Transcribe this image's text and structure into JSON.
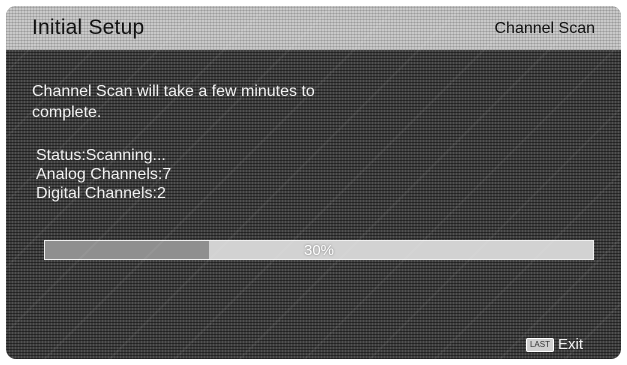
{
  "header": {
    "title": "Initial Setup",
    "subtitle": "Channel Scan"
  },
  "message": "Channel Scan will take a few minutes to complete.",
  "status": {
    "status_line": "Status:Scanning...",
    "analog_line": "Analog Channels:7",
    "digital_line": "Digital Channels:2"
  },
  "progress": {
    "percent": 30,
    "label": "30%"
  },
  "footer": {
    "key_label": "LAST",
    "action_label": "Exit"
  }
}
